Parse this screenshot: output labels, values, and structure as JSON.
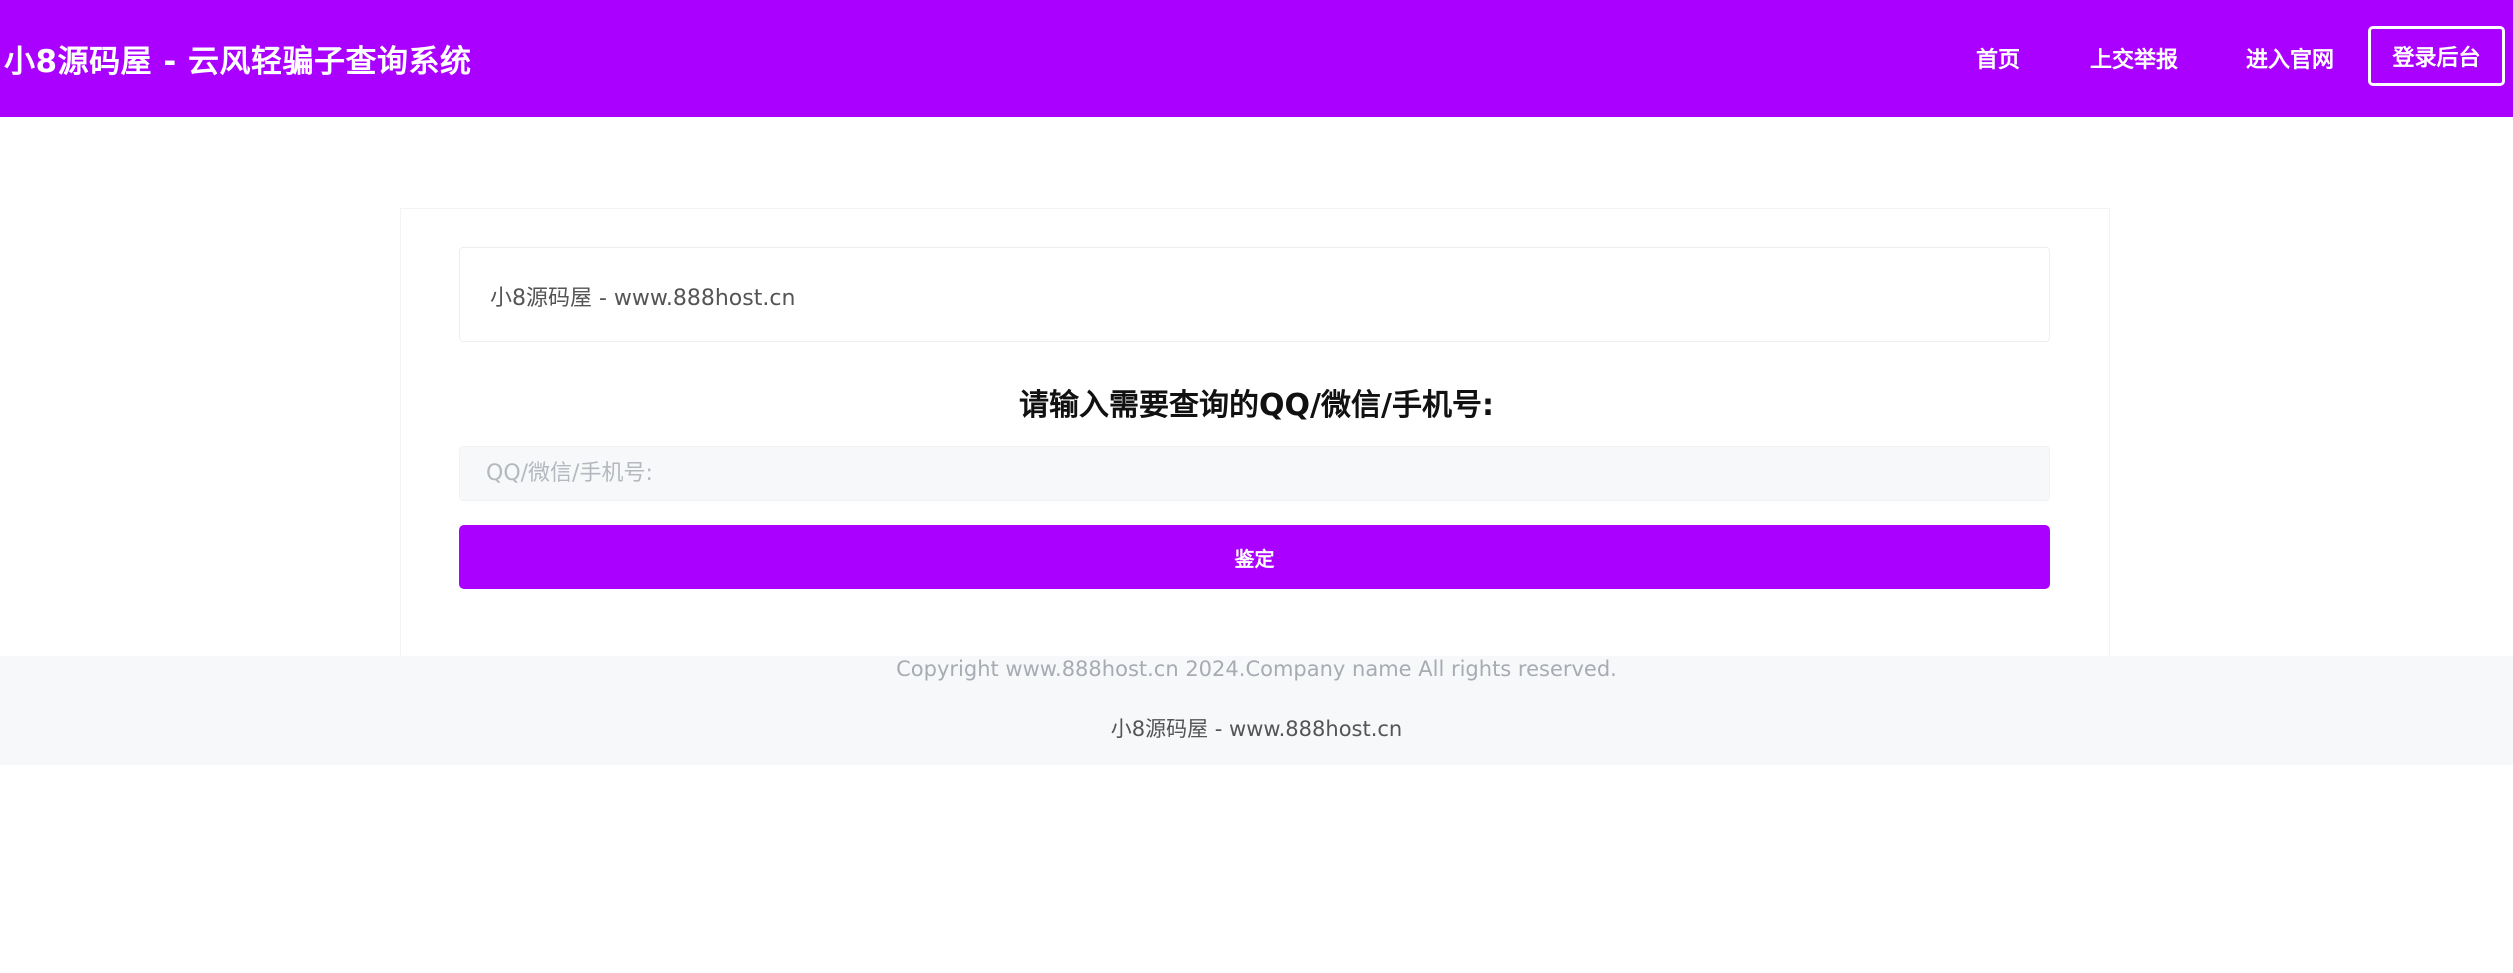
{
  "header": {
    "brand": "小8源码屋 - 云风轻骗子查询系统",
    "nav": {
      "home": "首页",
      "report": "上交举报",
      "official": "进入官网",
      "login": "登录后台"
    }
  },
  "main": {
    "notice": "小8源码屋 - www.888host.cn",
    "query_title": "请输入需要查询的QQ/微信/手机号:",
    "input": {
      "value": "",
      "placeholder": "QQ/微信/手机号:"
    },
    "submit_label": "鉴定"
  },
  "footer": {
    "copyright": "Copyright www.888host.cn 2024.Company name All rights reserved.",
    "brand": "小8源码屋 - www.888host.cn"
  },
  "colors": {
    "accent": "#aa00ff",
    "footer_bg": "#f7f8fa",
    "input_bg": "#f7f8fa"
  }
}
